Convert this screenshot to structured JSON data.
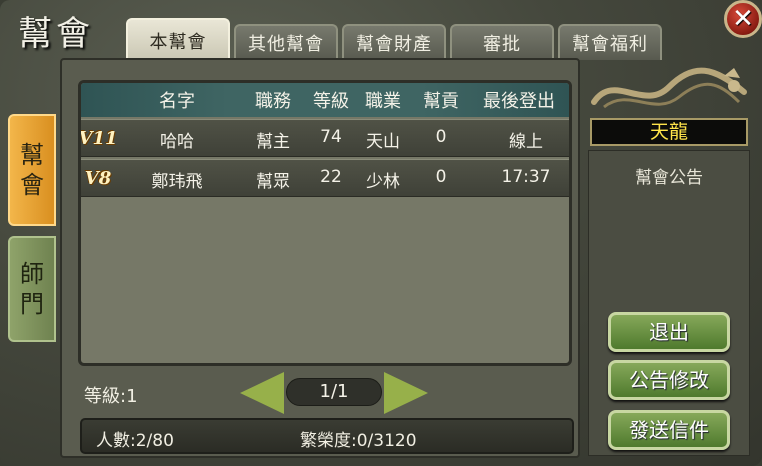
{
  "window": {
    "title": "幫會"
  },
  "tabs": [
    {
      "label": "本幫會"
    },
    {
      "label": "其他幫會"
    },
    {
      "label": "幫會財產"
    },
    {
      "label": "審批"
    },
    {
      "label": "幫會福利"
    }
  ],
  "side_tabs": [
    {
      "label": "幫\n會"
    },
    {
      "label": "師\n門"
    }
  ],
  "table": {
    "headers": [
      "名字",
      "職務",
      "等級",
      "職業",
      "幫貢",
      "最後登出"
    ],
    "rows": [
      {
        "vip": "V11",
        "name": "哈哈",
        "role": "幫主",
        "level": "74",
        "class": "天山",
        "contribution": "0",
        "last_logout": "線上"
      },
      {
        "vip": "V8",
        "name": "鄭玮飛",
        "role": "幫眾",
        "level": "22",
        "class": "少林",
        "contribution": "0",
        "last_logout": "17:37"
      }
    ]
  },
  "guild": {
    "name": "天龍",
    "notice_title": "幫會公告"
  },
  "buttons": {
    "exit": "退出",
    "edit_notice": "公告修改",
    "send_mail": "發送信件"
  },
  "footer": {
    "level_label": "等級:1",
    "page": "1/1",
    "members": "人數:2/80",
    "prosperity": "繁榮度:0/3120"
  },
  "colors": {
    "accent_green": "#97b04a",
    "guild_name": "#ffe44a",
    "active_side_tab": "#f3b64a"
  },
  "icons": {
    "close": "close-icon",
    "dragon": "dragon-emblem-icon",
    "prev": "left-arrow-icon",
    "next": "right-arrow-icon"
  }
}
